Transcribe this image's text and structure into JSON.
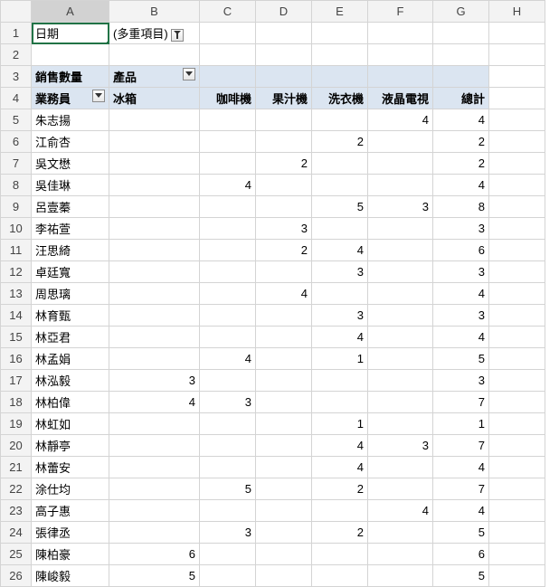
{
  "columns": [
    "A",
    "B",
    "C",
    "D",
    "E",
    "F",
    "G",
    "H"
  ],
  "active_row": 1,
  "active_col": "A",
  "report_filter": {
    "label": "日期",
    "value": "(多重項目)"
  },
  "pivot_labels": {
    "values_label": "銷售數量",
    "col_field": "產品",
    "row_field": "業務員"
  },
  "product_headers": [
    "冰箱",
    "咖啡機",
    "果汁機",
    "洗衣機",
    "液晶電視",
    "總計"
  ],
  "rows": [
    {
      "r": 5,
      "name": "朱志揚",
      "vals": [
        "",
        "",
        "",
        "",
        "4",
        "4"
      ]
    },
    {
      "r": 6,
      "name": "江俞杏",
      "vals": [
        "",
        "",
        "",
        "2",
        "",
        "2"
      ]
    },
    {
      "r": 7,
      "name": "吳文懋",
      "vals": [
        "",
        "",
        "2",
        "",
        "",
        "2"
      ]
    },
    {
      "r": 8,
      "name": "吳佳琳",
      "vals": [
        "",
        "4",
        "",
        "",
        "",
        "4"
      ]
    },
    {
      "r": 9,
      "name": "呂壹蓁",
      "vals": [
        "",
        "",
        "",
        "5",
        "3",
        "8"
      ]
    },
    {
      "r": 10,
      "name": "李祐萱",
      "vals": [
        "",
        "",
        "3",
        "",
        "",
        "3"
      ]
    },
    {
      "r": 11,
      "name": "汪思綺",
      "vals": [
        "",
        "",
        "2",
        "4",
        "",
        "6"
      ]
    },
    {
      "r": 12,
      "name": "卓廷寬",
      "vals": [
        "",
        "",
        "",
        "3",
        "",
        "3"
      ]
    },
    {
      "r": 13,
      "name": "周思璃",
      "vals": [
        "",
        "",
        "4",
        "",
        "",
        "4"
      ]
    },
    {
      "r": 14,
      "name": "林育甄",
      "vals": [
        "",
        "",
        "",
        "3",
        "",
        "3"
      ]
    },
    {
      "r": 15,
      "name": "林亞君",
      "vals": [
        "",
        "",
        "",
        "4",
        "",
        "4"
      ]
    },
    {
      "r": 16,
      "name": "林孟娟",
      "vals": [
        "",
        "4",
        "",
        "1",
        "",
        "5"
      ]
    },
    {
      "r": 17,
      "name": "林泓毅",
      "vals": [
        "3",
        "",
        "",
        "",
        "",
        "3"
      ]
    },
    {
      "r": 18,
      "name": "林柏偉",
      "vals": [
        "4",
        "3",
        "",
        "",
        "",
        "7"
      ]
    },
    {
      "r": 19,
      "name": "林虹如",
      "vals": [
        "",
        "",
        "",
        "1",
        "",
        "1"
      ]
    },
    {
      "r": 20,
      "name": "林靜亭",
      "vals": [
        "",
        "",
        "",
        "4",
        "3",
        "7"
      ]
    },
    {
      "r": 21,
      "name": "林蕾安",
      "vals": [
        "",
        "",
        "",
        "4",
        "",
        "4"
      ]
    },
    {
      "r": 22,
      "name": "涂仕均",
      "vals": [
        "",
        "5",
        "",
        "2",
        "",
        "7"
      ]
    },
    {
      "r": 23,
      "name": "高子惠",
      "vals": [
        "",
        "",
        "",
        "",
        "4",
        "4"
      ]
    },
    {
      "r": 24,
      "name": "張律丞",
      "vals": [
        "",
        "3",
        "",
        "2",
        "",
        "5"
      ]
    },
    {
      "r": 25,
      "name": "陳柏豪",
      "vals": [
        "6",
        "",
        "",
        "",
        "",
        "6"
      ]
    },
    {
      "r": 26,
      "name": "陳峻毅",
      "vals": [
        "5",
        "",
        "",
        "",
        "",
        "5"
      ]
    }
  ],
  "chart_data": {
    "type": "table",
    "title": "銷售數量",
    "row_field": "業務員",
    "col_field": "產品",
    "filter": {
      "field": "日期",
      "value": "(多重項目)"
    },
    "columns": [
      "冰箱",
      "咖啡機",
      "果汁機",
      "洗衣機",
      "液晶電視",
      "總計"
    ],
    "rows": [
      {
        "label": "朱志揚",
        "values": [
          null,
          null,
          null,
          null,
          4,
          4
        ]
      },
      {
        "label": "江俞杏",
        "values": [
          null,
          null,
          null,
          2,
          null,
          2
        ]
      },
      {
        "label": "吳文懋",
        "values": [
          null,
          null,
          2,
          null,
          null,
          2
        ]
      },
      {
        "label": "吳佳琳",
        "values": [
          null,
          4,
          null,
          null,
          null,
          4
        ]
      },
      {
        "label": "呂壹蓁",
        "values": [
          null,
          null,
          null,
          5,
          3,
          8
        ]
      },
      {
        "label": "李祐萱",
        "values": [
          null,
          null,
          3,
          null,
          null,
          3
        ]
      },
      {
        "label": "汪思綺",
        "values": [
          null,
          null,
          2,
          4,
          null,
          6
        ]
      },
      {
        "label": "卓廷寬",
        "values": [
          null,
          null,
          null,
          3,
          null,
          3
        ]
      },
      {
        "label": "周思璃",
        "values": [
          null,
          null,
          4,
          null,
          null,
          4
        ]
      },
      {
        "label": "林育甄",
        "values": [
          null,
          null,
          null,
          3,
          null,
          3
        ]
      },
      {
        "label": "林亞君",
        "values": [
          null,
          null,
          null,
          4,
          null,
          4
        ]
      },
      {
        "label": "林孟娟",
        "values": [
          null,
          4,
          null,
          1,
          null,
          5
        ]
      },
      {
        "label": "林泓毅",
        "values": [
          3,
          null,
          null,
          null,
          null,
          3
        ]
      },
      {
        "label": "林柏偉",
        "values": [
          4,
          3,
          null,
          null,
          null,
          7
        ]
      },
      {
        "label": "林虹如",
        "values": [
          null,
          null,
          null,
          1,
          null,
          1
        ]
      },
      {
        "label": "林靜亭",
        "values": [
          null,
          null,
          null,
          4,
          3,
          7
        ]
      },
      {
        "label": "林蕾安",
        "values": [
          null,
          null,
          null,
          4,
          null,
          4
        ]
      },
      {
        "label": "涂仕均",
        "values": [
          null,
          5,
          null,
          2,
          null,
          7
        ]
      },
      {
        "label": "高子惠",
        "values": [
          null,
          null,
          null,
          null,
          4,
          4
        ]
      },
      {
        "label": "張律丞",
        "values": [
          null,
          3,
          null,
          2,
          null,
          5
        ]
      },
      {
        "label": "陳柏豪",
        "values": [
          6,
          null,
          null,
          null,
          null,
          6
        ]
      },
      {
        "label": "陳峻毅",
        "values": [
          5,
          null,
          null,
          null,
          null,
          5
        ]
      }
    ]
  }
}
